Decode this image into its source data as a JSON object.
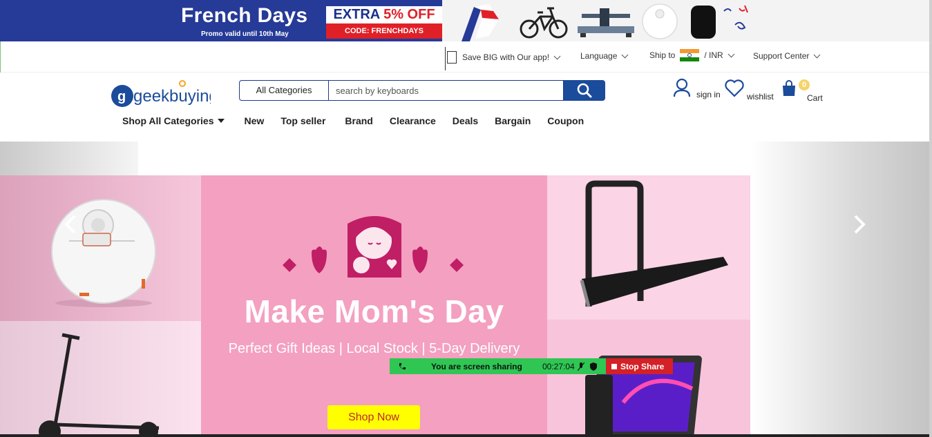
{
  "promo": {
    "title": "French Days",
    "subtitle": "Promo valid until 10th May",
    "offer_prefix": "EXTRA ",
    "offer_highlight": "5% OFF",
    "code": "CODE: FRENCHDAYS"
  },
  "utility": {
    "app": "Save BIG with Our app!",
    "language": "Language",
    "ship_to": "Ship to",
    "currency": "/ INR",
    "support": "Support Center"
  },
  "header": {
    "logo_text": "geekbuying",
    "category_select": "All Categories",
    "search_placeholder": "search by keyboards",
    "sign_in": "sign in",
    "wishlist": "wishlist",
    "cart": "Cart",
    "cart_count": "0"
  },
  "nav": {
    "all_categories": "Shop All Categories",
    "items": [
      "New",
      "Top seller",
      "Brand",
      "Clearance",
      "Deals",
      "Bargain",
      "Coupon"
    ]
  },
  "banner": {
    "headline": "Make Mom's Day",
    "tagline": "Perfect Gift Ideas | Local Stock | 5-Day Delivery",
    "cta": "Shop Now"
  },
  "screen_share": {
    "status": "You are screen sharing",
    "timer": "00:27:04",
    "stop": "Stop Share"
  },
  "colors": {
    "brand_blue": "#1b4b9b",
    "promo_blue": "#263a97",
    "promo_red": "#e02027",
    "banner_pink": "#f4a0c0",
    "cta_yellow": "#ffff00",
    "share_green": "#2fc654",
    "share_red": "#d42027"
  },
  "icons": [
    "search-icon",
    "user-icon",
    "heart-icon",
    "shopping-bag-icon",
    "chevron-down-icon",
    "caret-down-icon",
    "arrow-left-icon",
    "arrow-right-icon",
    "phone-icon",
    "mic-icon",
    "shield-icon",
    "stop-icon"
  ]
}
